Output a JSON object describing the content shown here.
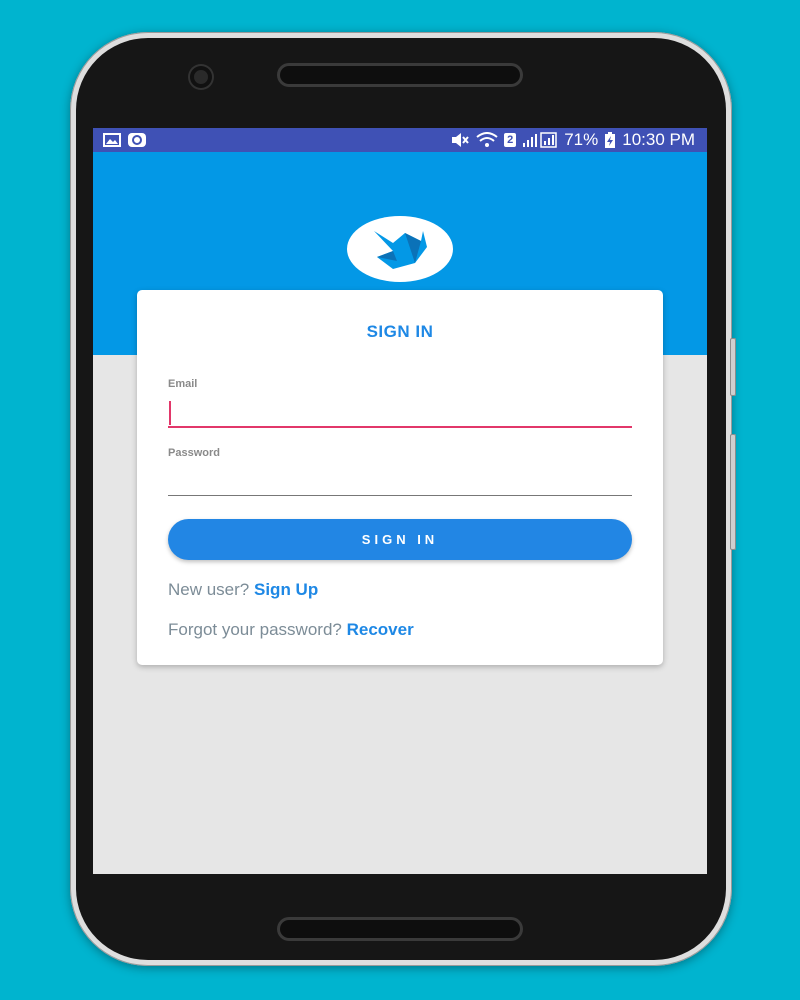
{
  "status_bar": {
    "battery": "71%",
    "time": "10:30 PM",
    "sim_badge": "2",
    "icons": [
      "image-icon",
      "assistant-icon",
      "mute-icon",
      "wifi-icon",
      "signal-icon",
      "battery-icon"
    ]
  },
  "app": {
    "logo": "app-logo-icon",
    "card_title": "SIGN IN",
    "email_label": "Email",
    "email_value": "",
    "password_label": "Password",
    "password_value": "",
    "signin_button": "SIGN IN",
    "new_user_prefix": "New user?",
    "new_user_link": "Sign Up",
    "forgot_prefix": "Forgot your password?",
    "forgot_link": "Recover"
  },
  "colors": {
    "background": "#00b4cf",
    "status_bar": "#3f51b5",
    "header_band": "#0398e6",
    "accent": "#1e88e5",
    "focus_underline": "#e2376a"
  }
}
